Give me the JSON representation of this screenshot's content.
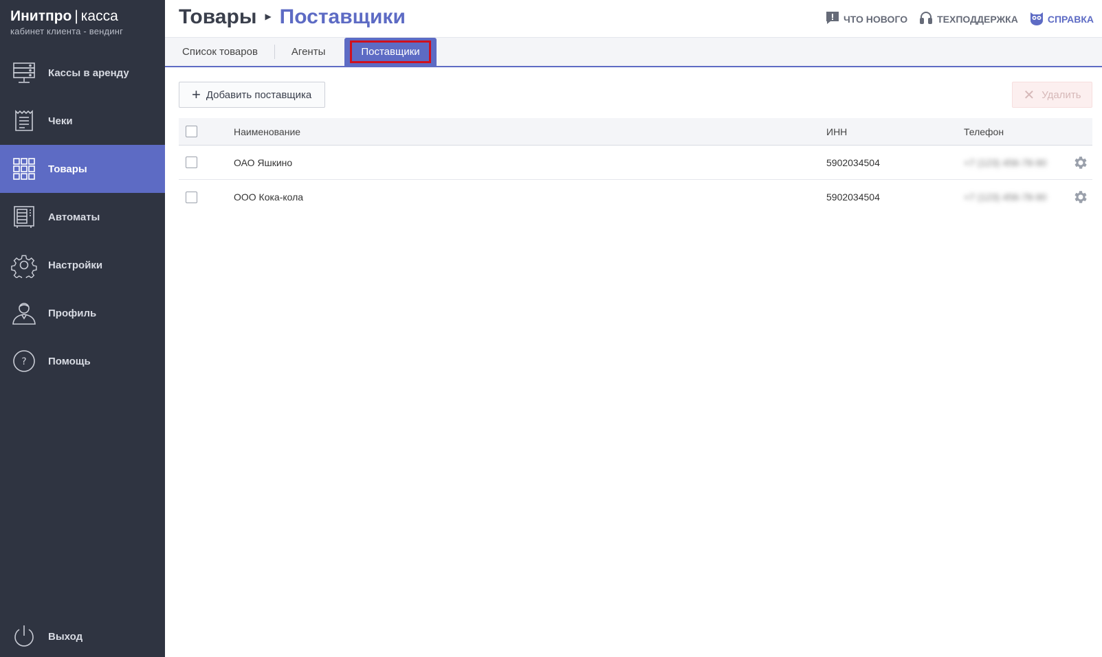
{
  "brand": {
    "name": "Инитпро",
    "separator": "|",
    "product": "касса",
    "subtitle": "кабинет клиента - вендинг"
  },
  "sidebar": {
    "items": [
      {
        "label": "Кассы в аренду",
        "icon": "server-icon",
        "active": false
      },
      {
        "label": "Чеки",
        "icon": "receipt-icon",
        "active": false
      },
      {
        "label": "Товары",
        "icon": "grid-icon",
        "active": true
      },
      {
        "label": "Автоматы",
        "icon": "vending-machine-icon",
        "active": false
      },
      {
        "label": "Настройки",
        "icon": "gear-icon",
        "active": false
      },
      {
        "label": "Профиль",
        "icon": "user-icon",
        "active": false
      },
      {
        "label": "Помощь",
        "icon": "help-icon",
        "active": false
      }
    ],
    "logout": {
      "label": "Выход",
      "icon": "power-icon"
    }
  },
  "header": {
    "breadcrumb_root": "Товары",
    "breadcrumb_separator": "›",
    "breadcrumb_current": "Поставщики",
    "links": [
      {
        "label": "ЧТО НОВОГО",
        "icon": "news-icon"
      },
      {
        "label": "ТЕХПОДДЕРЖКА",
        "icon": "headset-icon"
      },
      {
        "label": "СПРАВКА",
        "icon": "owl-icon"
      }
    ]
  },
  "tabs": [
    {
      "label": "Список товаров",
      "active": false
    },
    {
      "label": "Агенты",
      "active": false
    },
    {
      "label": "Поставщики",
      "active": true
    }
  ],
  "toolbar": {
    "add_label": "Добавить поставщика",
    "delete_label": "Удалить"
  },
  "table": {
    "columns": [
      "Наименование",
      "ИНН",
      "Телефон"
    ],
    "rows": [
      {
        "name": "ОАО Яшкино",
        "inn": "5902034504",
        "phone": "+7 (123) 456-78-90"
      },
      {
        "name": "ООО Кока-кола",
        "inn": "5902034504",
        "phone": "+7 (123) 456-78-90"
      }
    ]
  },
  "colors": {
    "sidebar_bg": "#2f3441",
    "accent": "#5d6bc4",
    "highlight_border": "#d0101d"
  }
}
